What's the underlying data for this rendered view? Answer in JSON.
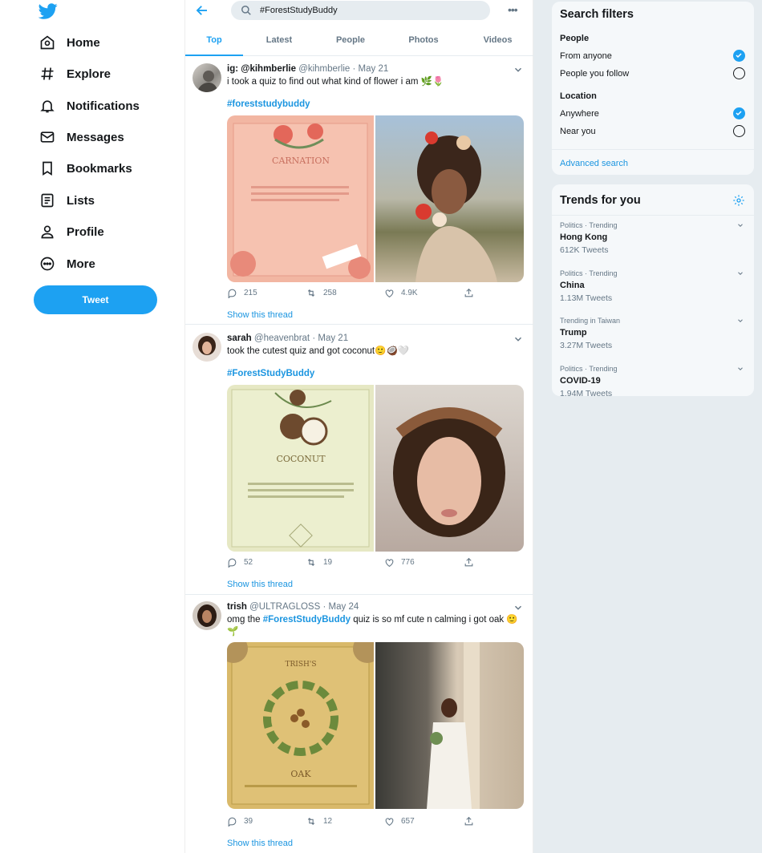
{
  "nav": {
    "items": [
      {
        "label": "Home",
        "icon": "home-icon"
      },
      {
        "label": "Explore",
        "icon": "hashtag-icon"
      },
      {
        "label": "Notifications",
        "icon": "bell-icon"
      },
      {
        "label": "Messages",
        "icon": "envelope-icon"
      },
      {
        "label": "Bookmarks",
        "icon": "bookmark-icon"
      },
      {
        "label": "Lists",
        "icon": "list-icon"
      },
      {
        "label": "Profile",
        "icon": "person-icon"
      },
      {
        "label": "More",
        "icon": "more-circle-icon"
      }
    ],
    "tweet_button": "Tweet"
  },
  "search": {
    "value": "#ForestStudyBuddy"
  },
  "tabs": [
    "Top",
    "Latest",
    "People",
    "Photos",
    "Videos"
  ],
  "tweets": [
    {
      "name": "ig: @kihmberlie",
      "handle": "@kihmberlie",
      "date": "May 21",
      "text": "i took a quiz to find out what kind of flower i am 🌿🌷",
      "hashtag": "#foreststudybuddy",
      "replies": "215",
      "retweets": "258",
      "likes": "4.9K",
      "show_thread": "Show this thread"
    },
    {
      "name": "sarah",
      "handle": "@heavenbrat",
      "date": "May 21",
      "text": "took the cutest quiz and got coconut🙂🥥🤍",
      "hashtag": "#ForestStudyBuddy",
      "replies": "52",
      "retweets": "19",
      "likes": "776",
      "show_thread": "Show this thread"
    },
    {
      "name": "trish",
      "handle": "@ULTRAGLOSS",
      "date": "May 24",
      "text_pre": "omg the ",
      "hashtag": "#ForestStudyBuddy",
      "text_post": " quiz is so mf cute n calming i got oak 🙂 🌱",
      "replies": "39",
      "retweets": "12",
      "likes": "657",
      "show_thread": "Show this thread"
    }
  ],
  "filters": {
    "title": "Search filters",
    "people_label": "People",
    "people_options": [
      "From anyone",
      "People you follow"
    ],
    "location_label": "Location",
    "location_options": [
      "Anywhere",
      "Near you"
    ],
    "advanced": "Advanced search"
  },
  "trends": {
    "title": "Trends for you",
    "items": [
      {
        "meta": "Politics · Trending",
        "name": "Hong Kong",
        "count": "612K Tweets"
      },
      {
        "meta": "Politics · Trending",
        "name": "China",
        "count": "1.13M Tweets"
      },
      {
        "meta": "Trending in Taiwan",
        "name": "Trump",
        "count": "3.27M Tweets"
      },
      {
        "meta": "Politics · Trending",
        "name": "COVID-19",
        "count": "1.94M Tweets"
      }
    ]
  },
  "colors": {
    "accent": "#1da1f2",
    "link": "#1b95e0"
  }
}
